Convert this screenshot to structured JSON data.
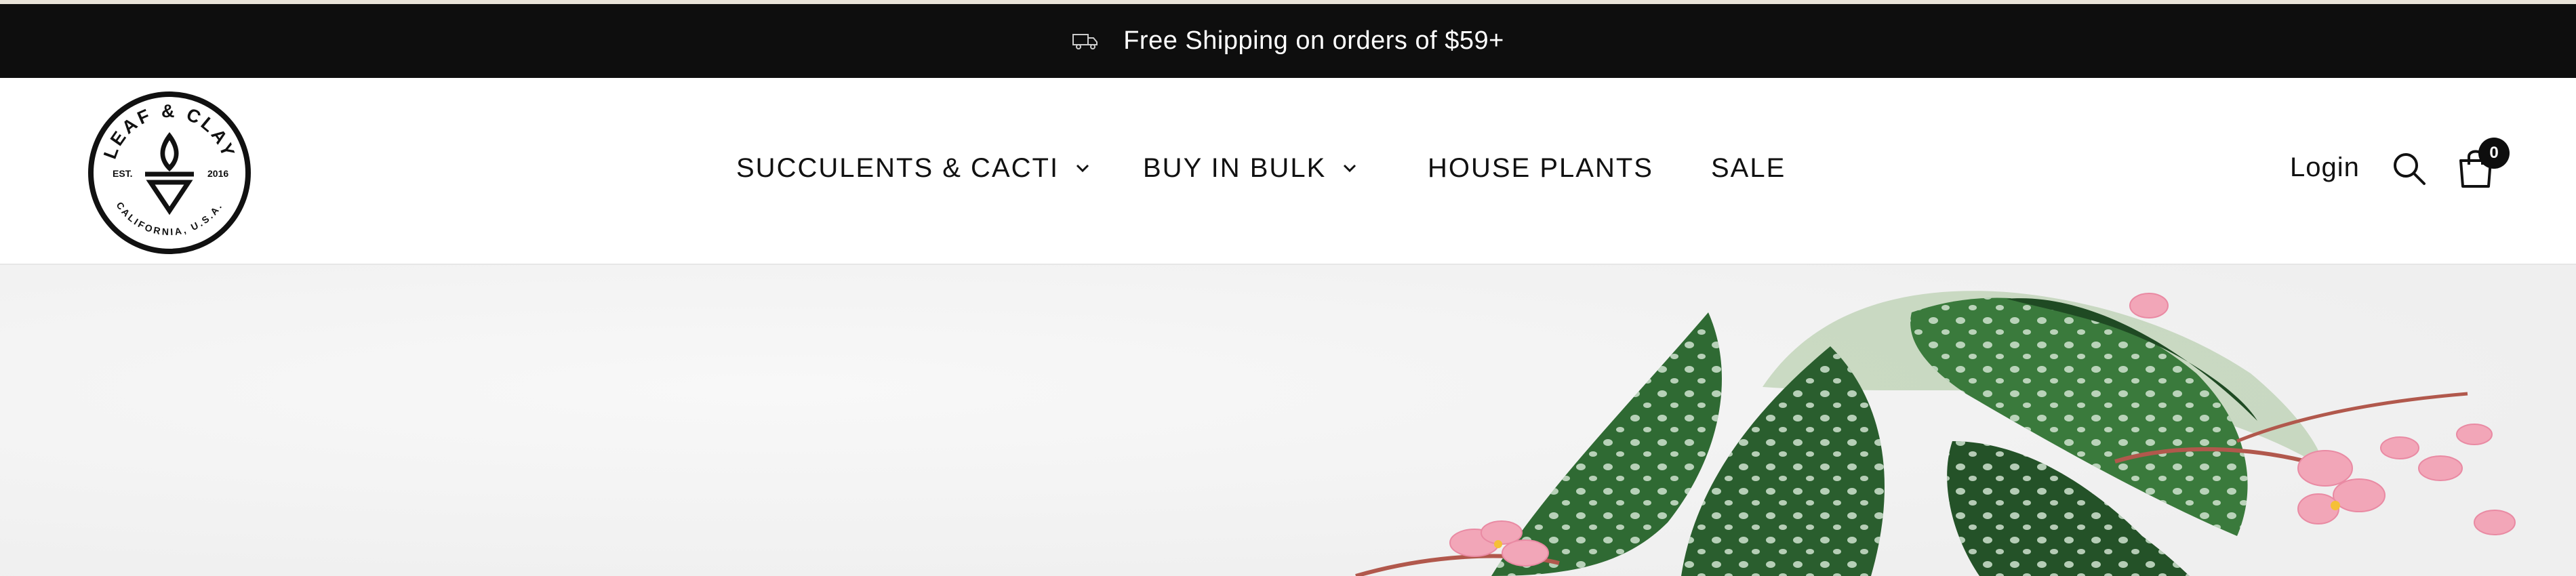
{
  "announcement": {
    "icon": "truck-icon",
    "text": "Free Shipping on orders of $59+"
  },
  "logo": {
    "brand": "LEAF & CLAY",
    "est_label": "EST.",
    "year": "2016",
    "location": "CALIFORNIA, U.S.A."
  },
  "nav": {
    "items": [
      {
        "label": "SUCCULENTS & CACTI",
        "has_dropdown": true
      },
      {
        "label": "BUY IN BULK",
        "has_dropdown": true
      },
      {
        "label": "HOUSE PLANTS",
        "has_dropdown": false
      },
      {
        "label": "SALE",
        "has_dropdown": false
      }
    ]
  },
  "header_actions": {
    "login_label": "Login",
    "search_icon": "search-icon",
    "cart_icon": "shopping-bag-icon",
    "cart_count": "0"
  },
  "colors": {
    "announcement_bg": "#0e0e0e",
    "header_bg": "#ffffff",
    "hero_bg": "#f3f3f3",
    "leaf_green": "#2f6a33",
    "flower_pink": "#f2a6b8"
  }
}
